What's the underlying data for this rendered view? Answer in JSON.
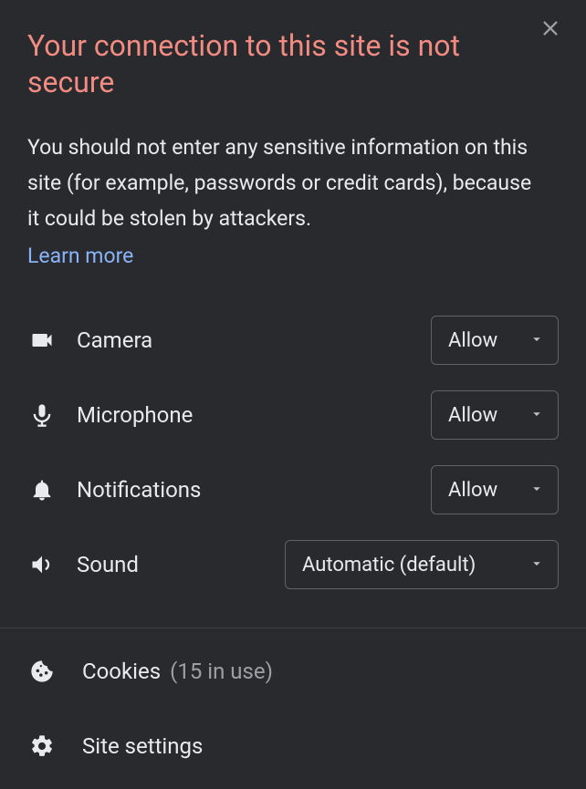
{
  "header": {
    "title": "Your connection to this site is not secure",
    "description": "You should not enter any sensitive information on this site (for example, passwords or credit cards), because it could be stolen by attackers.",
    "learn_more": "Learn more"
  },
  "permissions": [
    {
      "icon": "camera-icon",
      "label": "Camera",
      "value": "Allow",
      "wide": false
    },
    {
      "icon": "microphone-icon",
      "label": "Microphone",
      "value": "Allow",
      "wide": false
    },
    {
      "icon": "notifications-icon",
      "label": "Notifications",
      "value": "Allow",
      "wide": false
    },
    {
      "icon": "sound-icon",
      "label": "Sound",
      "value": "Automatic (default)",
      "wide": true
    }
  ],
  "footer": {
    "cookies_label": "Cookies",
    "cookies_count": "(15 in use)",
    "settings_label": "Site settings"
  }
}
